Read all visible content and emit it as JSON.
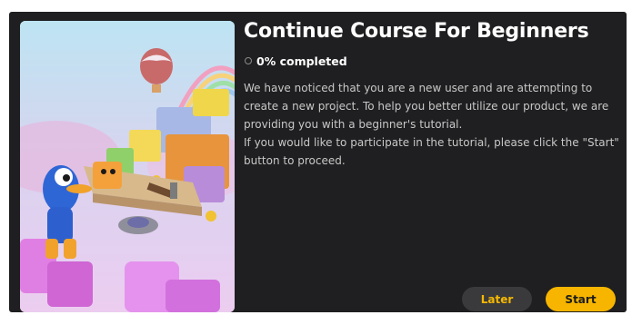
{
  "dialog": {
    "title": "Continue Course For Beginners",
    "progress_text": "0% completed",
    "progress_value": 0,
    "description": [
      "We have noticed that you are a new user and are attempting to create a new project. To help you better utilize our product, we are providing you with a beginner's tutorial.",
      "If you would like to participate in the tutorial, please click the \"Start\" button to proceed."
    ],
    "buttons": {
      "later_label": "Later",
      "start_label": "Start"
    }
  },
  "colors": {
    "dialog_bg": "#1f1f21",
    "accent": "#f7b500",
    "secondary_button_bg": "#3a3a3c"
  }
}
